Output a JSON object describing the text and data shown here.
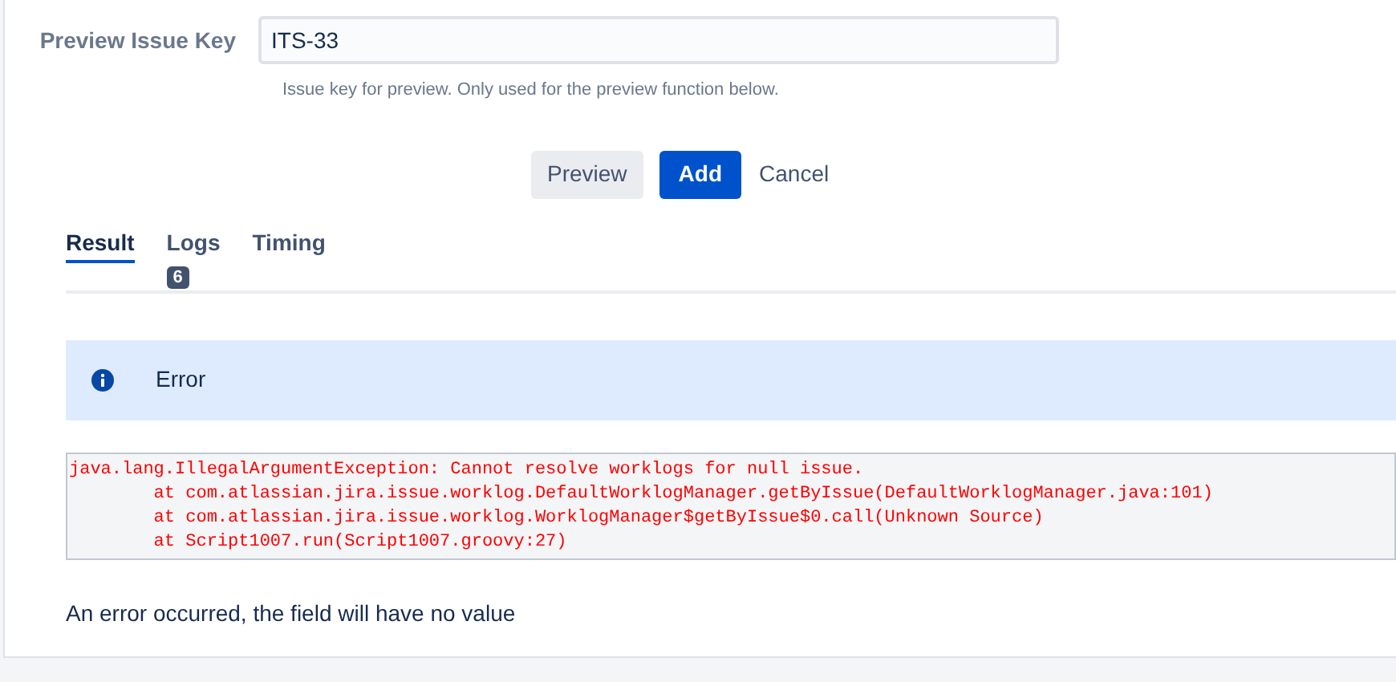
{
  "preview_field": {
    "label": "Preview Issue Key",
    "value": "ITS-33",
    "help": "Issue key for preview. Only used for the preview function below."
  },
  "buttons": [
    {
      "label": "Preview",
      "kind": "secondary"
    },
    {
      "label": "Add",
      "kind": "primary"
    },
    {
      "label": "Cancel",
      "kind": "link"
    }
  ],
  "tabs": [
    {
      "label": "Result",
      "selected": true
    },
    {
      "label": "Logs",
      "selected": false,
      "badge": "6"
    },
    {
      "label": "Timing",
      "selected": false
    }
  ],
  "alert": {
    "title": "Error"
  },
  "stack_trace": [
    "java.lang.IllegalArgumentException: Cannot resolve worklogs for null issue.",
    "        at com.atlassian.jira.issue.worklog.DefaultWorklogManager.getByIssue(DefaultWorklogManager.java:101)",
    "        at com.atlassian.jira.issue.worklog.WorklogManager$getByIssue$0.call(Unknown Source)",
    "        at Script1007.run(Script1007.groovy:27)"
  ],
  "message": "An error occurred, the field will have no value"
}
